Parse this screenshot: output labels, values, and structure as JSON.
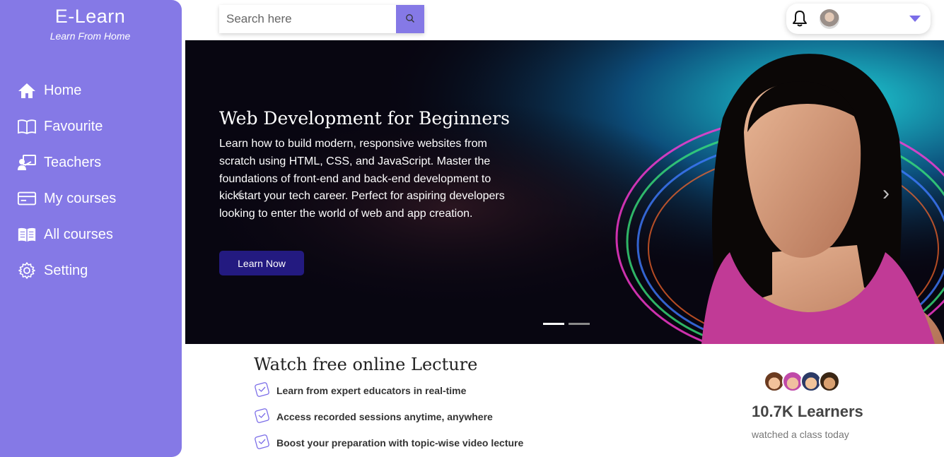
{
  "sidebar": {
    "brand_title": "E-Learn",
    "brand_subtitle": "Learn From Home",
    "items": [
      {
        "label": "Home",
        "icon": "home-icon"
      },
      {
        "label": "Favourite",
        "icon": "book-open-icon"
      },
      {
        "label": "Teachers",
        "icon": "teacher-icon"
      },
      {
        "label": "My courses",
        "icon": "card-icon"
      },
      {
        "label": "All courses",
        "icon": "library-icon"
      },
      {
        "label": "Setting",
        "icon": "gear-icon"
      }
    ]
  },
  "search": {
    "placeholder": "Search here",
    "button_icon": "search-icon"
  },
  "user_menu": {
    "bell_icon": "bell-icon",
    "caret_icon": "caret-down-icon"
  },
  "hero": {
    "title": "Web Development for Beginners",
    "description": "Learn how to build modern, responsive websites from scratch using HTML, CSS, and JavaScript. Master the foundations of front-end and back-end development to kickstart your tech career. Perfect for aspiring developers looking to enter the world of web and app creation.",
    "button_label": "Learn Now",
    "prev_arrow": "‹",
    "next_arrow": "›",
    "active_slide": 1,
    "slide_count": 2
  },
  "lecture": {
    "title": "Watch free online Lecture",
    "features": [
      "Learn from expert educators in real-time",
      "Access recorded sessions anytime, anywhere",
      "Boost your preparation with topic-wise video lecture"
    ]
  },
  "learners": {
    "count": "10.7K Learners",
    "subtitle": "watched a class today"
  },
  "colors": {
    "accent": "#8579e6",
    "button": "#231a80"
  }
}
